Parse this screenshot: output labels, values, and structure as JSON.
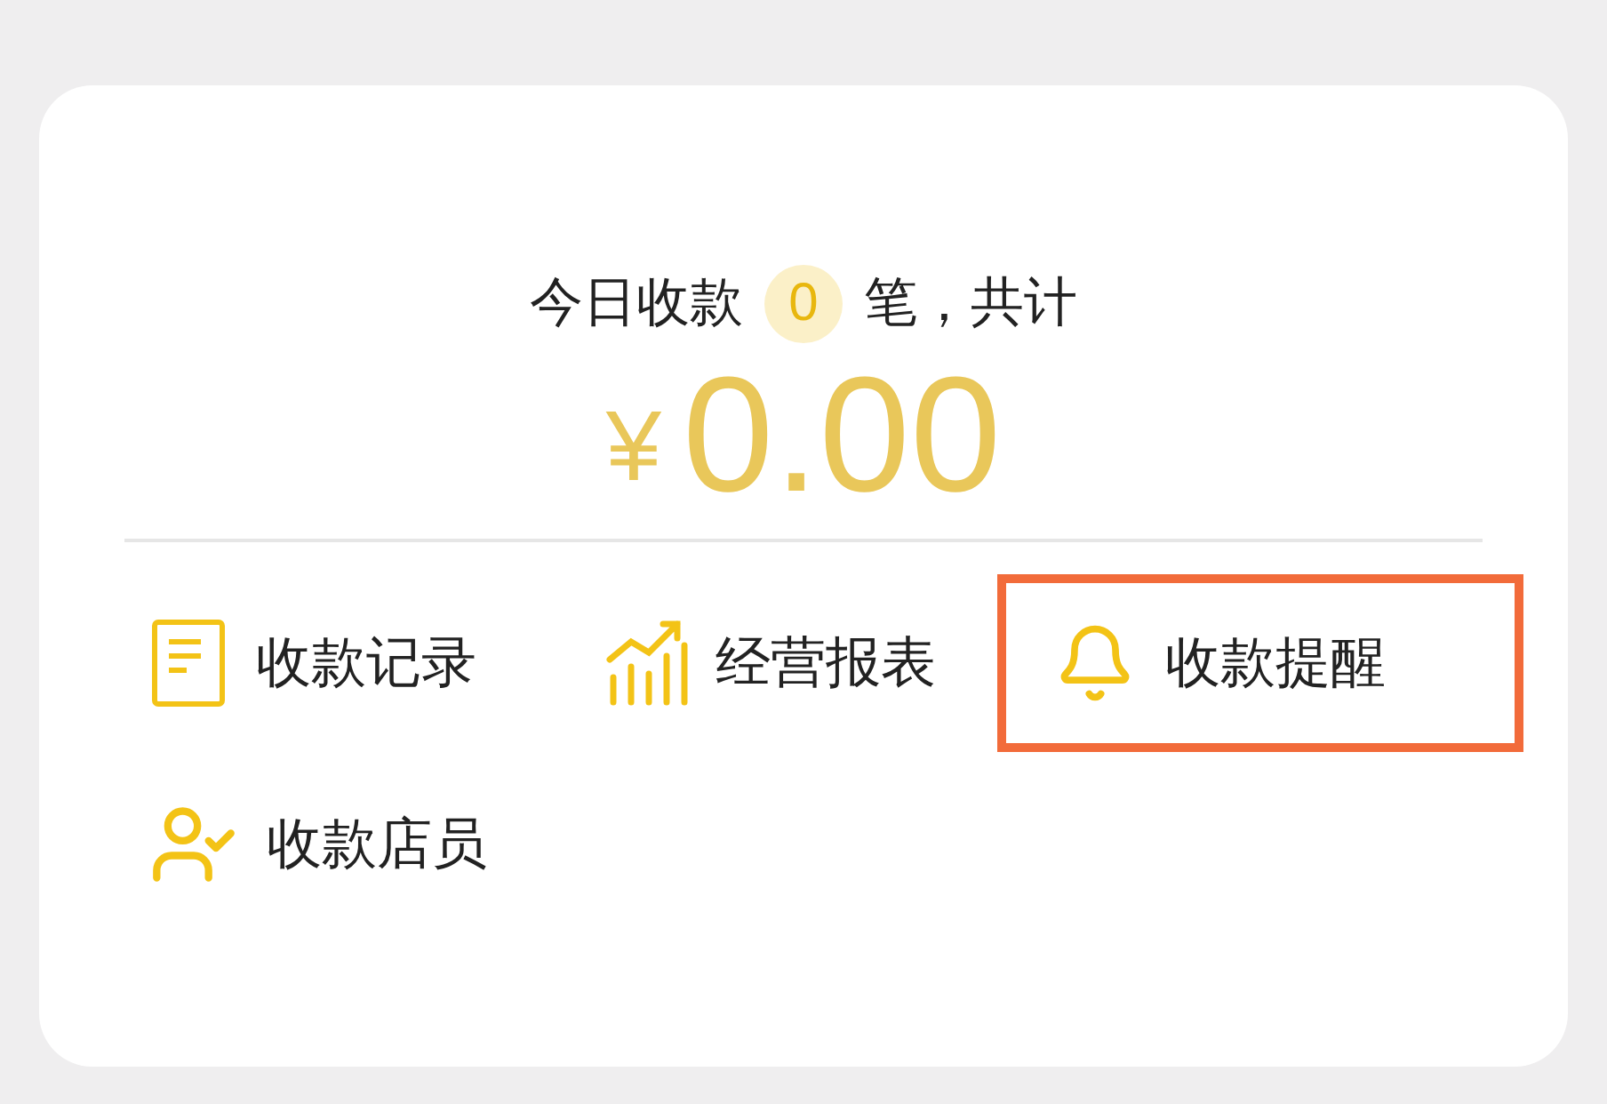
{
  "summary": {
    "prefix": "今日收款",
    "count": "0",
    "suffix": "笔，共计",
    "currency": "¥",
    "amount": "0.00"
  },
  "menu": [
    {
      "kind": "records",
      "label": "收款记录",
      "highlighted": false
    },
    {
      "kind": "report",
      "label": "经营报表",
      "highlighted": false
    },
    {
      "kind": "reminder",
      "label": "收款提醒",
      "highlighted": true
    },
    {
      "kind": "staff",
      "label": "收款店员",
      "highlighted": false
    }
  ]
}
